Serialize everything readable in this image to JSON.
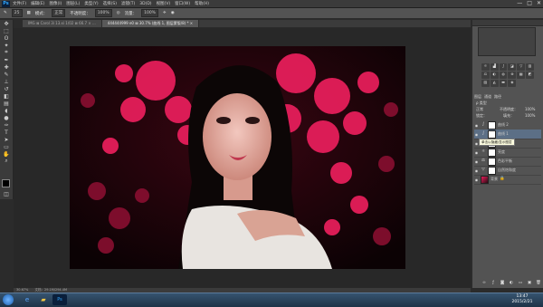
{
  "menubar": {
    "app_badge": "Ps",
    "items": [
      "文件(F)",
      "编辑(E)",
      "图像(I)",
      "图层(L)",
      "类型(Y)",
      "选择(S)",
      "滤镜(T)",
      "3D(D)",
      "视图(V)",
      "窗口(W)",
      "帮助(H)"
    ],
    "window_buttons": [
      "—",
      "□",
      "✕"
    ]
  },
  "options": {
    "size": "25",
    "mode_label": "模式：",
    "mode_value": "正常",
    "opacity_label": "不透明度：",
    "opacity_value": "100%",
    "flow_label": "流量：",
    "flow_value": "100%"
  },
  "tabs": [
    {
      "label": "IMG ⊠ Carol 3i 13.xi 1/02 ⊠ 66.7 × ..."
    },
    {
      "label": "444444999 e0 ⊠ 30.7% (曲线 1, 图层蒙版/8) * ×",
      "active": true
    }
  ],
  "layers_panel": {
    "tabs": [
      "图层",
      "通道",
      "路径"
    ],
    "filter_label": "ρ 类型",
    "blend_mode": "正常",
    "opacity_label": "不透明度：",
    "opacity_value": "100%",
    "lock_label": "锁定：",
    "fill_label": "填充：",
    "fill_value": "100%",
    "layers": [
      {
        "name": "曲线 2",
        "thumb": "white",
        "selected": false
      },
      {
        "name": "曲线 1",
        "thumb": "white",
        "selected": true
      },
      {
        "name": "色阶",
        "thumb": "white",
        "selected": false
      },
      {
        "name": "亮度",
        "thumb": "white",
        "selected": false
      },
      {
        "name": "色彩平衡",
        "thumb": "white",
        "selected": false
      },
      {
        "name": "自然饱和度",
        "thumb": "white",
        "selected": false
      },
      {
        "name": "背景",
        "thumb": "img",
        "selected": false
      }
    ],
    "tooltip": "单击以隐藏/显示图层"
  },
  "status": {
    "zoom": "30.67%",
    "doc": "文档：29.1M/294.4M"
  },
  "taskbar": {
    "time": "13:47",
    "date": "2015/2/21"
  },
  "colors": {
    "accent": "#e51e5a",
    "selected_layer": "#5c6f86"
  }
}
